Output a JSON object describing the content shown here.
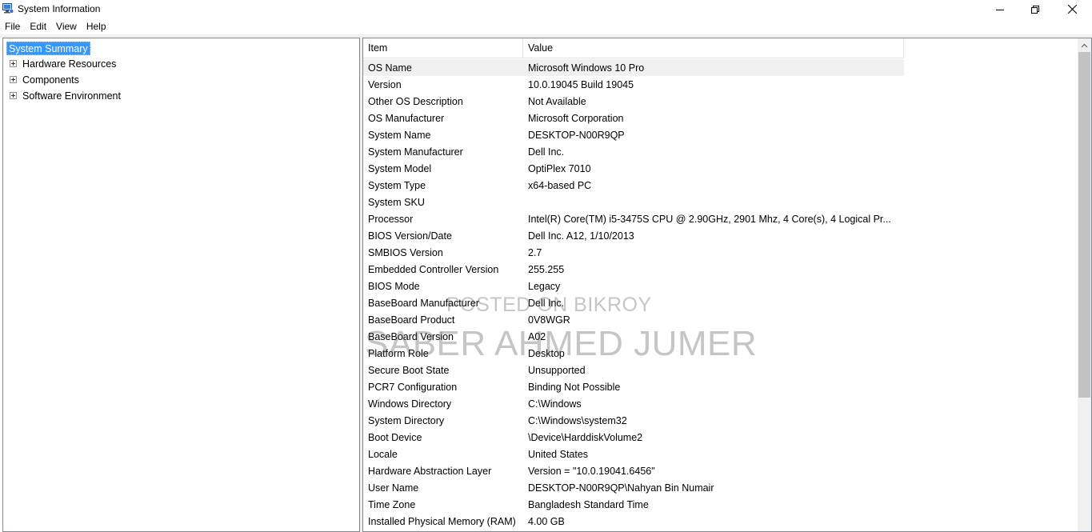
{
  "window": {
    "title": "System Information",
    "icon": "system-information-icon",
    "controls": {
      "minimize": "minimize-icon",
      "maximize": "restore-icon",
      "close": "close-icon"
    }
  },
  "menu": [
    "File",
    "Edit",
    "View",
    "Help"
  ],
  "tree": {
    "root": "System Summary",
    "children": [
      "Hardware Resources",
      "Components",
      "Software Environment"
    ]
  },
  "list": {
    "columns": [
      "Item",
      "Value"
    ],
    "rows": [
      [
        "OS Name",
        "Microsoft Windows 10 Pro"
      ],
      [
        "Version",
        "10.0.19045 Build 19045"
      ],
      [
        "Other OS Description",
        "Not Available"
      ],
      [
        "OS Manufacturer",
        "Microsoft Corporation"
      ],
      [
        "System Name",
        "DESKTOP-N00R9QP"
      ],
      [
        "System Manufacturer",
        "Dell Inc."
      ],
      [
        "System Model",
        "OptiPlex 7010"
      ],
      [
        "System Type",
        "x64-based PC"
      ],
      [
        "System SKU",
        ""
      ],
      [
        "Processor",
        "Intel(R) Core(TM) i5-3475S CPU @ 2.90GHz, 2901 Mhz, 4 Core(s), 4 Logical Pr..."
      ],
      [
        "BIOS Version/Date",
        "Dell Inc. A12, 1/10/2013"
      ],
      [
        "SMBIOS Version",
        "2.7"
      ],
      [
        "Embedded Controller Version",
        "255.255"
      ],
      [
        "BIOS Mode",
        "Legacy"
      ],
      [
        "BaseBoard Manufacturer",
        "Dell Inc."
      ],
      [
        "BaseBoard Product",
        "0V8WGR"
      ],
      [
        "BaseBoard Version",
        "A02"
      ],
      [
        "Platform Role",
        "Desktop"
      ],
      [
        "Secure Boot State",
        "Unsupported"
      ],
      [
        "PCR7 Configuration",
        "Binding Not Possible"
      ],
      [
        "Windows Directory",
        "C:\\Windows"
      ],
      [
        "System Directory",
        "C:\\Windows\\system32"
      ],
      [
        "Boot Device",
        "\\Device\\HarddiskVolume2"
      ],
      [
        "Locale",
        "United States"
      ],
      [
        "Hardware Abstraction Layer",
        "Version = \"10.0.19041.6456\""
      ],
      [
        "User Name",
        "DESKTOP-N00R9QP\\Nahyan Bin Numair"
      ],
      [
        "Time Zone",
        "Bangladesh Standard Time"
      ],
      [
        "Installed Physical Memory (RAM)",
        "4.00 GB"
      ]
    ]
  },
  "watermark": {
    "line1": "POSTED ON BIKROY",
    "line2": "SABER AHMED JUMER"
  },
  "colors": {
    "selection": "#3399ff",
    "border": "#828790",
    "scrollbar": "#f0f0f0",
    "thumb": "#c2c2c2"
  }
}
